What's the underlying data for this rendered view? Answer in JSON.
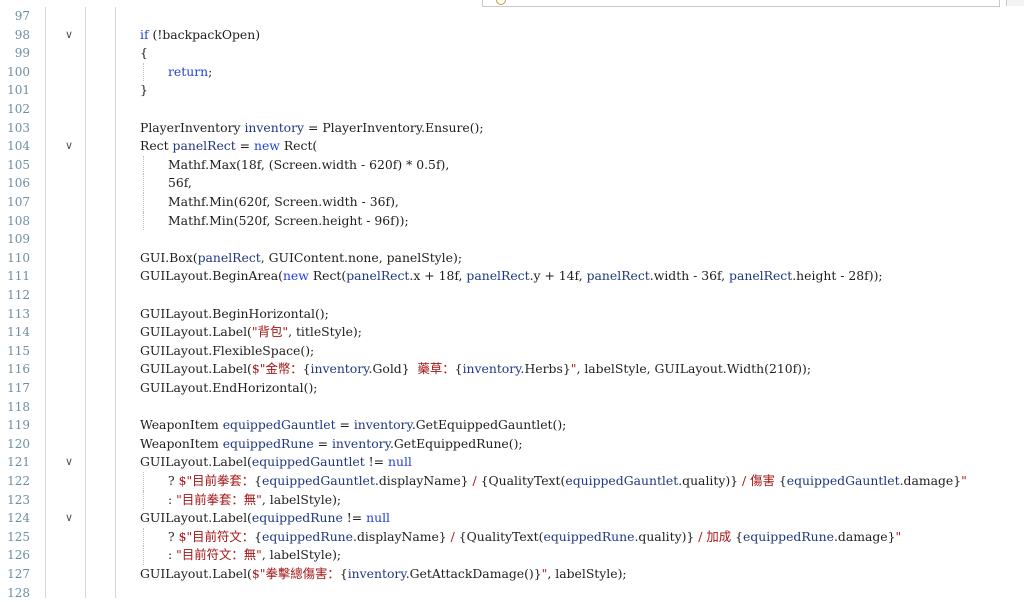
{
  "editor": {
    "lines": [
      {
        "n": "97",
        "fold": false,
        "indent": 0,
        "tokens": []
      },
      {
        "n": "98",
        "fold": true,
        "indent": 0,
        "tokens": [
          [
            "kw",
            "if"
          ],
          [
            "t",
            " (!backpackOpen)"
          ]
        ]
      },
      {
        "n": "99",
        "fold": false,
        "indent": 0,
        "tokens": [
          [
            "t",
            "{"
          ]
        ]
      },
      {
        "n": "100",
        "fold": false,
        "indent": 1,
        "tokens": [
          [
            "kw",
            "return"
          ],
          [
            "t",
            ";"
          ]
        ]
      },
      {
        "n": "101",
        "fold": false,
        "indent": 0,
        "tokens": [
          [
            "t",
            "}"
          ]
        ]
      },
      {
        "n": "102",
        "fold": false,
        "indent": 0,
        "tokens": []
      },
      {
        "n": "103",
        "fold": false,
        "indent": 0,
        "tokens": [
          [
            "t",
            "PlayerInventory "
          ],
          [
            "var",
            "inventory"
          ],
          [
            "t",
            " = PlayerInventory.Ensure();"
          ]
        ]
      },
      {
        "n": "104",
        "fold": true,
        "indent": 0,
        "tokens": [
          [
            "t",
            "Rect "
          ],
          [
            "var",
            "panelRect"
          ],
          [
            "t",
            " = "
          ],
          [
            "kw",
            "new"
          ],
          [
            "t",
            " Rect("
          ]
        ]
      },
      {
        "n": "105",
        "fold": false,
        "indent": 1,
        "tokens": [
          [
            "t",
            "Mathf.Max(18f, (Screen.width - 620f) * 0.5f),"
          ]
        ]
      },
      {
        "n": "106",
        "fold": false,
        "indent": 1,
        "tokens": [
          [
            "t",
            "56f,"
          ]
        ]
      },
      {
        "n": "107",
        "fold": false,
        "indent": 1,
        "tokens": [
          [
            "t",
            "Mathf.Min(620f, Screen.width - 36f),"
          ]
        ]
      },
      {
        "n": "108",
        "fold": false,
        "indent": 1,
        "tokens": [
          [
            "t",
            "Mathf.Min(520f, Screen.height - 96f));"
          ]
        ]
      },
      {
        "n": "109",
        "fold": false,
        "indent": 0,
        "tokens": []
      },
      {
        "n": "110",
        "fold": false,
        "indent": 0,
        "tokens": [
          [
            "t",
            "GUI.Box("
          ],
          [
            "var",
            "panelRect"
          ],
          [
            "t",
            ", GUIContent.none, panelStyle);"
          ]
        ]
      },
      {
        "n": "111",
        "fold": false,
        "indent": 0,
        "tokens": [
          [
            "t",
            "GUILayout.BeginArea("
          ],
          [
            "kw",
            "new"
          ],
          [
            "t",
            " Rect("
          ],
          [
            "var",
            "panelRect"
          ],
          [
            "t",
            ".x + 18f, "
          ],
          [
            "var",
            "panelRect"
          ],
          [
            "t",
            ".y + 14f, "
          ],
          [
            "var",
            "panelRect"
          ],
          [
            "t",
            ".width - 36f, "
          ],
          [
            "var",
            "panelRect"
          ],
          [
            "t",
            ".height - 28f));"
          ]
        ]
      },
      {
        "n": "112",
        "fold": false,
        "indent": 0,
        "tokens": []
      },
      {
        "n": "113",
        "fold": false,
        "indent": 0,
        "tokens": [
          [
            "t",
            "GUILayout.BeginHorizontal();"
          ]
        ]
      },
      {
        "n": "114",
        "fold": false,
        "indent": 0,
        "tokens": [
          [
            "t",
            "GUILayout.Label("
          ],
          [
            "str",
            "\"背包\""
          ],
          [
            "t",
            ", titleStyle);"
          ]
        ]
      },
      {
        "n": "115",
        "fold": false,
        "indent": 0,
        "tokens": [
          [
            "t",
            "GUILayout.FlexibleSpace();"
          ]
        ]
      },
      {
        "n": "116",
        "fold": false,
        "indent": 0,
        "tokens": [
          [
            "t",
            "GUILayout.Label("
          ],
          [
            "str",
            "$\"金幣："
          ],
          [
            "t",
            "{"
          ],
          [
            "var",
            "inventory"
          ],
          [
            "t",
            ".Gold}"
          ],
          [
            "str",
            "  藥草："
          ],
          [
            "t",
            "{"
          ],
          [
            "var",
            "inventory"
          ],
          [
            "t",
            ".Herbs}"
          ],
          [
            "str",
            "\""
          ],
          [
            "t",
            ", labelStyle, GUILayout.Width(210f));"
          ]
        ]
      },
      {
        "n": "117",
        "fold": false,
        "indent": 0,
        "tokens": [
          [
            "t",
            "GUILayout.EndHorizontal();"
          ]
        ]
      },
      {
        "n": "118",
        "fold": false,
        "indent": 0,
        "tokens": []
      },
      {
        "n": "119",
        "fold": false,
        "indent": 0,
        "tokens": [
          [
            "t",
            "WeaponItem "
          ],
          [
            "var",
            "equippedGauntlet"
          ],
          [
            "t",
            " = "
          ],
          [
            "var",
            "inventory"
          ],
          [
            "t",
            ".GetEquippedGauntlet();"
          ]
        ]
      },
      {
        "n": "120",
        "fold": false,
        "indent": 0,
        "tokens": [
          [
            "t",
            "WeaponItem "
          ],
          [
            "var",
            "equippedRune"
          ],
          [
            "t",
            " = "
          ],
          [
            "var",
            "inventory"
          ],
          [
            "t",
            ".GetEquippedRune();"
          ]
        ]
      },
      {
        "n": "121",
        "fold": true,
        "indent": 0,
        "tokens": [
          [
            "t",
            "GUILayout.Label("
          ],
          [
            "var",
            "equippedGauntlet"
          ],
          [
            "t",
            " != "
          ],
          [
            "kw",
            "null"
          ]
        ]
      },
      {
        "n": "122",
        "fold": false,
        "indent": 1,
        "tokens": [
          [
            "t",
            "? "
          ],
          [
            "str",
            "$\"目前拳套："
          ],
          [
            "t",
            "{"
          ],
          [
            "var",
            "equippedGauntlet"
          ],
          [
            "t",
            ".displayName}"
          ],
          [
            "str",
            " / "
          ],
          [
            "t",
            "{QualityText("
          ],
          [
            "var",
            "equippedGauntlet"
          ],
          [
            "t",
            ".quality)}"
          ],
          [
            "str",
            " / 傷害 "
          ],
          [
            "t",
            "{"
          ],
          [
            "var",
            "equippedGauntlet"
          ],
          [
            "t",
            ".damage}"
          ],
          [
            "str",
            "\""
          ]
        ]
      },
      {
        "n": "123",
        "fold": false,
        "indent": 1,
        "tokens": [
          [
            "t",
            ": "
          ],
          [
            "str",
            "\"目前拳套：無\""
          ],
          [
            "t",
            ", labelStyle);"
          ]
        ]
      },
      {
        "n": "124",
        "fold": true,
        "indent": 0,
        "tokens": [
          [
            "t",
            "GUILayout.Label("
          ],
          [
            "var",
            "equippedRune"
          ],
          [
            "t",
            " != "
          ],
          [
            "kw",
            "null"
          ]
        ]
      },
      {
        "n": "125",
        "fold": false,
        "indent": 1,
        "tokens": [
          [
            "t",
            "? "
          ],
          [
            "str",
            "$\"目前符文："
          ],
          [
            "t",
            "{"
          ],
          [
            "var",
            "equippedRune"
          ],
          [
            "t",
            ".displayName}"
          ],
          [
            "str",
            " / "
          ],
          [
            "t",
            "{QualityText("
          ],
          [
            "var",
            "equippedRune"
          ],
          [
            "t",
            ".quality)}"
          ],
          [
            "str",
            " / 加成 "
          ],
          [
            "t",
            "{"
          ],
          [
            "var",
            "equippedRune"
          ],
          [
            "t",
            ".damage}"
          ],
          [
            "str",
            "\""
          ]
        ]
      },
      {
        "n": "126",
        "fold": false,
        "indent": 1,
        "tokens": [
          [
            "t",
            ": "
          ],
          [
            "str",
            "\"目前符文：無\""
          ],
          [
            "t",
            ", labelStyle);"
          ]
        ]
      },
      {
        "n": "127",
        "fold": false,
        "indent": 0,
        "tokens": [
          [
            "t",
            "GUILayout.Label("
          ],
          [
            "str",
            "$\"拳擊總傷害："
          ],
          [
            "t",
            "{"
          ],
          [
            "var",
            "inventory"
          ],
          [
            "t",
            ".GetAttackDamage()}"
          ],
          [
            "str",
            "\""
          ],
          [
            "t",
            ", labelStyle);"
          ]
        ]
      },
      {
        "n": "128",
        "fold": false,
        "indent": 0,
        "tokens": []
      }
    ]
  }
}
